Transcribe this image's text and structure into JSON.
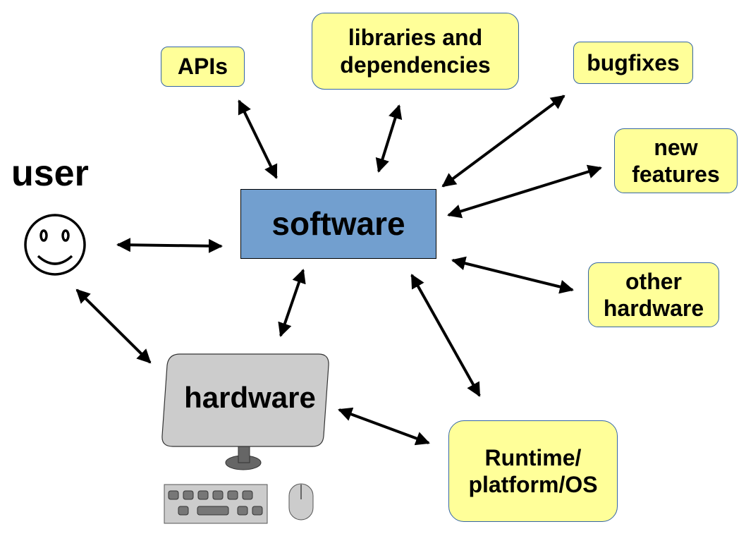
{
  "diagram": {
    "center": "software",
    "user_label": "user",
    "hardware_label": "hardware",
    "nodes": {
      "apis": "APIs",
      "libraries": "libraries and\ndependencies",
      "bugfixes": "bugfixes",
      "new_features": "new\nfeatures",
      "other_hardware": "other\nhardware",
      "runtime": "Runtime/\nplatform/OS"
    },
    "connections": [
      {
        "from": "software",
        "to": "APIs",
        "type": "bidirectional"
      },
      {
        "from": "software",
        "to": "libraries and dependencies",
        "type": "bidirectional"
      },
      {
        "from": "software",
        "to": "bugfixes",
        "type": "bidirectional"
      },
      {
        "from": "software",
        "to": "new features",
        "type": "bidirectional"
      },
      {
        "from": "software",
        "to": "other hardware",
        "type": "bidirectional"
      },
      {
        "from": "software",
        "to": "Runtime/platform/OS",
        "type": "bidirectional"
      },
      {
        "from": "software",
        "to": "hardware",
        "type": "bidirectional"
      },
      {
        "from": "software",
        "to": "user",
        "type": "bidirectional"
      },
      {
        "from": "user",
        "to": "hardware",
        "type": "bidirectional"
      },
      {
        "from": "hardware",
        "to": "Runtime/platform/OS",
        "type": "bidirectional"
      }
    ],
    "colors": {
      "software_fill": "#729fcf",
      "note_fill": "#ffff99",
      "note_border": "#3465a4",
      "hardware_fill": "#cccccc",
      "hardware_dark": "#666666"
    }
  }
}
